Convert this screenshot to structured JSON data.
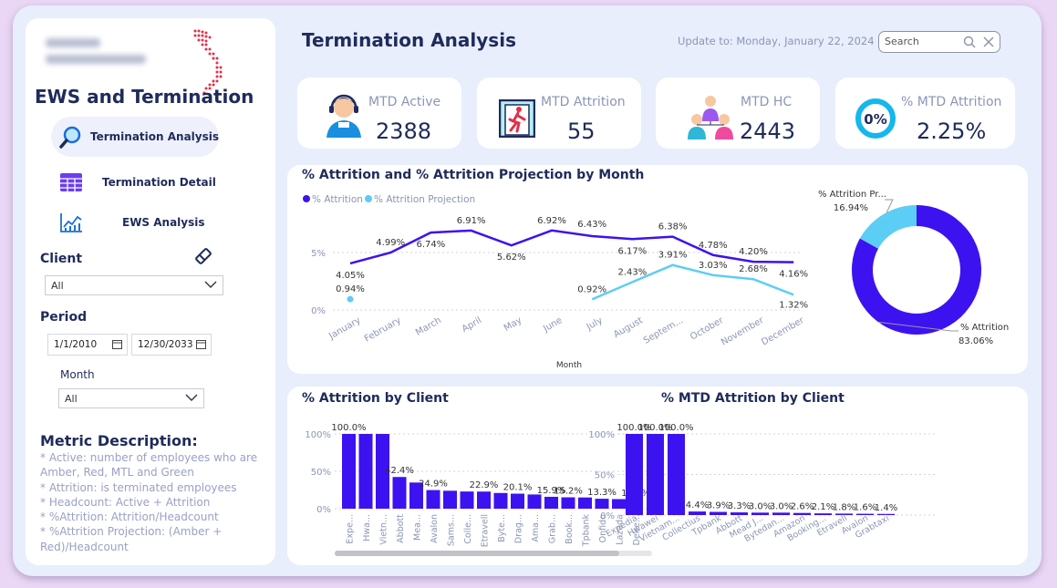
{
  "colors": {
    "attrition": "#3d12f0",
    "projection": "#5ccdf5",
    "title": "#1f2b5b",
    "muted": "#8b96b6"
  },
  "sidebar": {
    "title": "EWS and Termination",
    "nav": [
      {
        "label": "Termination Analysis",
        "icon": "magnifier-icon",
        "active": true
      },
      {
        "label": "Termination Detail",
        "icon": "table-icon",
        "active": false
      },
      {
        "label": "EWS Analysis",
        "icon": "line-chart-icon",
        "active": false
      }
    ],
    "client_label": "Client",
    "client_value": "All",
    "period_label": "Period",
    "period_start": "1/1/2010",
    "period_end": "12/30/2033",
    "month_label": "Month",
    "month_value": "All",
    "metric_title": "Metric Description:",
    "metric_lines": [
      "* Active: number of employees who are",
      "Amber, Red, MTL and Green",
      "* Attrition: is terminated employees",
      "* Headcount: Active + Attrition",
      "* %Attrition: Attrition/Headcount",
      "* %Attrition Projection: (Amber +",
      "Red)/Headcount"
    ]
  },
  "header": {
    "title": "Termination Analysis",
    "update": "Update to: Monday, January 22, 2024",
    "search_placeholder": "Search"
  },
  "kpis": [
    {
      "label": "MTD Active",
      "value": "2388",
      "icon": "agent-headset-icon"
    },
    {
      "label": "MTD Attrition",
      "value": "55",
      "icon": "exit-door-icon"
    },
    {
      "label": "MTD HC",
      "value": "2443",
      "icon": "team-icon"
    },
    {
      "label": "% MTD Attrition",
      "value": "2.25%",
      "icon": "percent-ring-icon",
      "ring_text": "0%"
    }
  ],
  "chart_data": [
    {
      "type": "line",
      "title": "% Attrition and % Attrition Projection by Month",
      "xlabel": "Month",
      "ylabel": "",
      "categories": [
        "January",
        "February",
        "March",
        "April",
        "May",
        "June",
        "July",
        "August",
        "Septem...",
        "October",
        "November",
        "December"
      ],
      "y_ticks": [
        "0%",
        "5%"
      ],
      "ylim": [
        0,
        8
      ],
      "series": [
        {
          "name": "% Attrition",
          "values": [
            4.05,
            4.99,
            6.74,
            6.91,
            5.62,
            6.92,
            6.43,
            6.17,
            6.38,
            4.78,
            4.2,
            4.16
          ],
          "labels": [
            "4.05%",
            "4.99%",
            "6.74%",
            "6.91%",
            "5.62%",
            "6.92%",
            "6.43%",
            "6.17%",
            "6.38%",
            "4.78%",
            "4.20%",
            "4.16%"
          ]
        },
        {
          "name": "% Attrition Projection",
          "values": [
            0.94,
            null,
            null,
            null,
            null,
            null,
            0.92,
            2.43,
            3.91,
            3.03,
            2.68,
            1.32
          ],
          "labels": [
            "0.94%",
            null,
            null,
            null,
            null,
            null,
            "0.92%",
            "2.43%",
            "3.91%",
            "3.03%",
            "2.68%",
            "1.32%"
          ]
        }
      ]
    },
    {
      "type": "pie",
      "title": "",
      "slices": [
        {
          "name": "% Attrition",
          "value": 83.06,
          "label": "83.06%"
        },
        {
          "name": "% Attrition Pr...",
          "value": 16.94,
          "label": "16.94%"
        }
      ]
    },
    {
      "type": "bar",
      "title": "% Attrition by Client",
      "y_ticks": [
        "0%",
        "50%",
        "100%"
      ],
      "ylim": [
        0,
        100
      ],
      "categories": [
        "Expe...",
        "Hwa...",
        "Vietn...",
        "Abbott",
        "Mea...",
        "Avalon",
        "Sams...",
        "Colle...",
        "Etravell",
        "Byte...",
        "Drag...",
        "Ama...",
        "Grab...",
        "Book...",
        "Tpbank",
        "Onfido",
        "Lazada",
        "Delre..."
      ],
      "values": [
        100,
        100,
        100,
        42.4,
        35,
        24.9,
        24,
        23,
        22.9,
        21,
        20.1,
        19,
        15.9,
        15.2,
        15,
        13.3,
        12.8,
        12.5
      ],
      "data_labels": [
        "100.0%",
        null,
        null,
        "42.4%",
        null,
        "24.9%",
        null,
        null,
        "22.9%",
        null,
        "20.1%",
        null,
        "15.9%",
        "15.2%",
        null,
        "13.3%",
        null,
        "12.5%"
      ]
    },
    {
      "type": "bar",
      "title": "% MTD Attrition by Client",
      "y_ticks": [
        "0%",
        "50%",
        "100%"
      ],
      "ylim": [
        0,
        100
      ],
      "categories": [
        "Expedia",
        "Hwawei",
        "Vietnam...",
        "Collectius",
        "Tpbank",
        "Abbott",
        "Mead J...",
        "Bytedan...",
        "Amazon",
        "Booking...",
        "Etravell",
        "Avalon",
        "Grabtaxi"
      ],
      "values": [
        100,
        100,
        100,
        4.4,
        3.9,
        3.3,
        3.0,
        3.0,
        2.6,
        2.1,
        1.8,
        1.6,
        1.4
      ],
      "data_labels": [
        "100.0%",
        "100.0%",
        "100.0%",
        "4.4%",
        "3.9%",
        "3.3%",
        "3.0%",
        "3.0%",
        "2.6%",
        "2.1%",
        "1.8%",
        "1.6%",
        "1.4%"
      ]
    }
  ]
}
